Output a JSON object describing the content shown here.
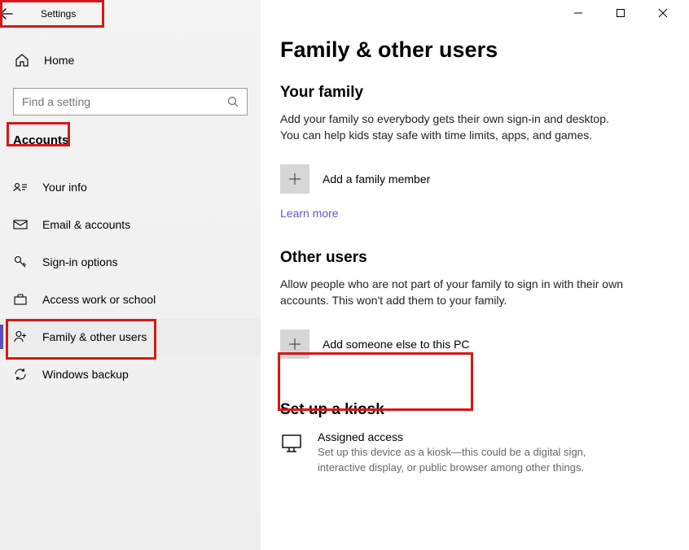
{
  "titlebar": {
    "label": "Settings"
  },
  "home": {
    "label": "Home"
  },
  "search": {
    "placeholder": "Find a setting"
  },
  "section_head": "Accounts",
  "nav": [
    {
      "id": "your-info",
      "label": "Your info"
    },
    {
      "id": "email-accounts",
      "label": "Email & accounts"
    },
    {
      "id": "signin-options",
      "label": "Sign-in options"
    },
    {
      "id": "access-work",
      "label": "Access work or school"
    },
    {
      "id": "family-other",
      "label": "Family & other users"
    },
    {
      "id": "windows-backup",
      "label": "Windows backup"
    }
  ],
  "main": {
    "title": "Family & other users",
    "family": {
      "heading": "Your family",
      "desc": "Add your family so everybody gets their own sign-in and desktop. You can help kids stay safe with time limits, apps, and games.",
      "add_label": "Add a family member",
      "learn_more": "Learn more"
    },
    "other": {
      "heading": "Other users",
      "desc": "Allow people who are not part of your family to sign in with their own accounts. This won't add them to your family.",
      "add_label": "Add someone else to this PC"
    },
    "kiosk": {
      "heading": "Set up a kiosk",
      "item_title": "Assigned access",
      "item_desc": "Set up this device as a kiosk—this could be a digital sign, interactive display, or public browser among other things."
    }
  }
}
